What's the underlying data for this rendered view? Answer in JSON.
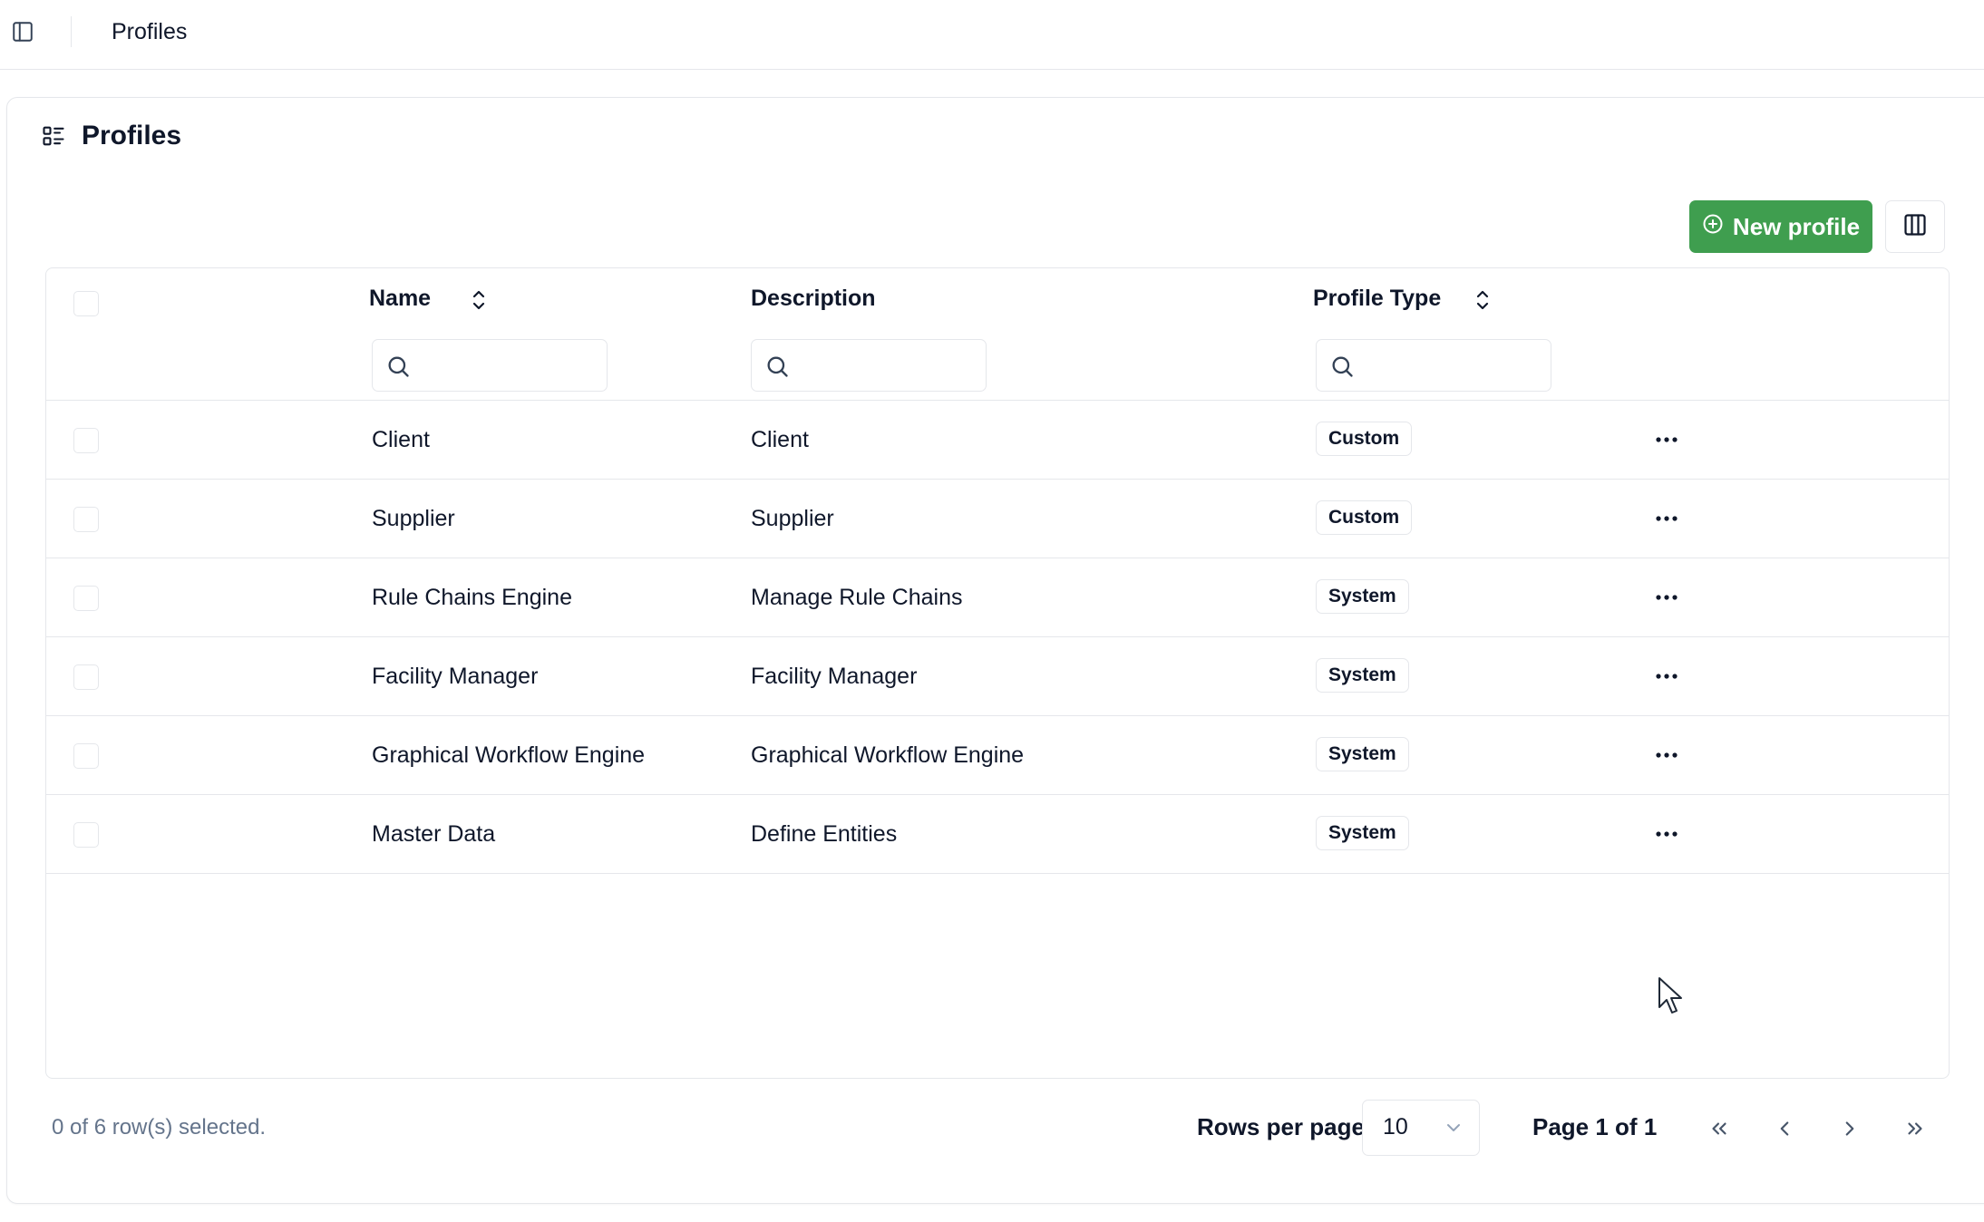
{
  "topbar": {
    "title": "Profiles"
  },
  "card": {
    "title": "Profiles"
  },
  "toolbar": {
    "new_profile_label": "New profile",
    "accent": "#3f9e4f"
  },
  "table": {
    "columns": [
      {
        "label": "Name",
        "sortable": true
      },
      {
        "label": "Description",
        "sortable": false
      },
      {
        "label": "Profile Type",
        "sortable": true
      }
    ],
    "rows": [
      {
        "name": "Client",
        "description": "Client",
        "type": "Custom"
      },
      {
        "name": "Supplier",
        "description": "Supplier",
        "type": "Custom"
      },
      {
        "name": "Rule Chains Engine",
        "description": "Manage Rule Chains",
        "type": "System"
      },
      {
        "name": "Facility Manager",
        "description": "Facility Manager",
        "type": "System"
      },
      {
        "name": "Graphical Workflow Engine",
        "description": "Graphical Workflow Engine",
        "type": "System"
      },
      {
        "name": "Master Data",
        "description": "Define Entities",
        "type": "System"
      }
    ]
  },
  "footer": {
    "selection_text": "0 of 6 row(s) selected.",
    "rows_per_page_label": "Rows per page",
    "rows_per_page_value": "10",
    "page_info": "Page 1 of 1"
  },
  "icons": {
    "sidebar_toggle": "sidebar-toggle-icon",
    "title": "list-details-icon",
    "new": "plus-circle-icon",
    "columns": "columns-icon",
    "sort": "chevrons-up-down-icon",
    "search": "search-icon",
    "more": "ellipsis-icon",
    "pagination": [
      "chevrons-left-icon",
      "chevron-left-icon",
      "chevron-right-icon",
      "chevrons-right-icon"
    ]
  }
}
